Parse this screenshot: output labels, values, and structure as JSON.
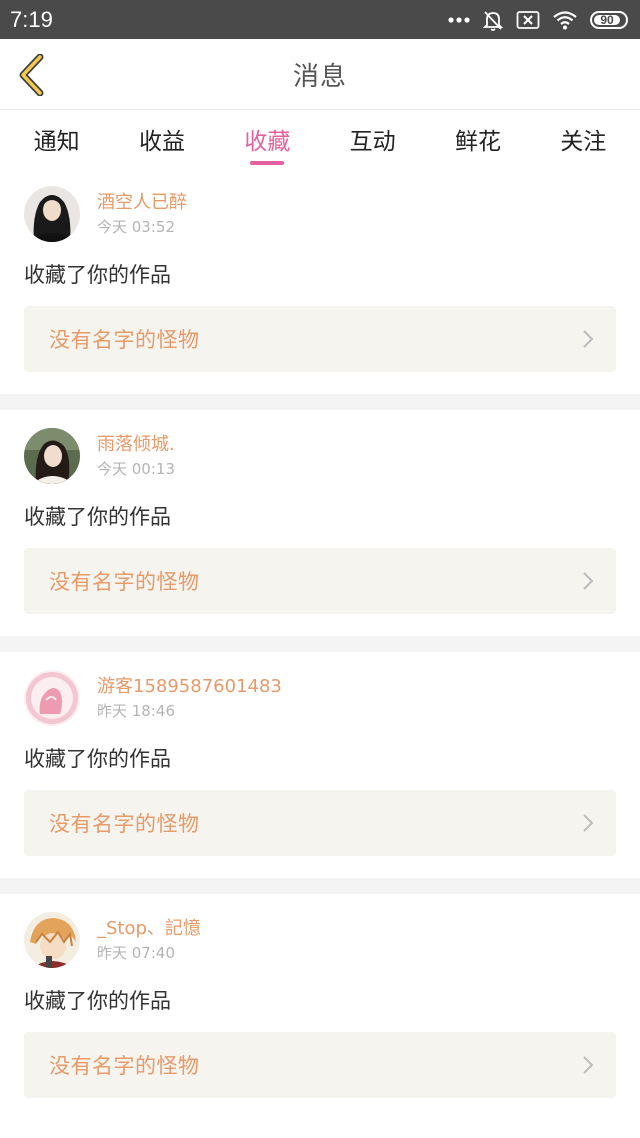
{
  "status_bar": {
    "time": "7:19",
    "battery_level": "90",
    "icons": [
      "more-dots-icon",
      "bell-off-icon",
      "sim-x-icon",
      "wifi-icon",
      "battery-icon"
    ]
  },
  "header": {
    "title": "消息",
    "back_icon": "chevron-left-icon"
  },
  "tabs": [
    {
      "label": "通知",
      "active": false
    },
    {
      "label": "收益",
      "active": false
    },
    {
      "label": "收藏",
      "active": true
    },
    {
      "label": "互动",
      "active": false
    },
    {
      "label": "鲜花",
      "active": false
    },
    {
      "label": "关注",
      "active": false
    }
  ],
  "colors": {
    "accent": "#e5609f",
    "name_color": "#e79a6a",
    "status_bar": "#4a4a4a",
    "link_bg": "#f5f4ee"
  },
  "notifications": [
    {
      "user": "酒空人已醉",
      "time": "今天 03:52",
      "action": "收藏了你的作品",
      "work": "没有名字的怪物"
    },
    {
      "user": "雨落倾城.",
      "time": "今天 00:13",
      "action": "收藏了你的作品",
      "work": "没有名字的怪物"
    },
    {
      "user": "游客1589587601483",
      "time": "昨天 18:46",
      "action": "收藏了你的作品",
      "work": "没有名字的怪物"
    },
    {
      "user": "_Stop、記憶",
      "time": "昨天 07:40",
      "action": "收藏了你的作品",
      "work": "没有名字的怪物"
    }
  ]
}
